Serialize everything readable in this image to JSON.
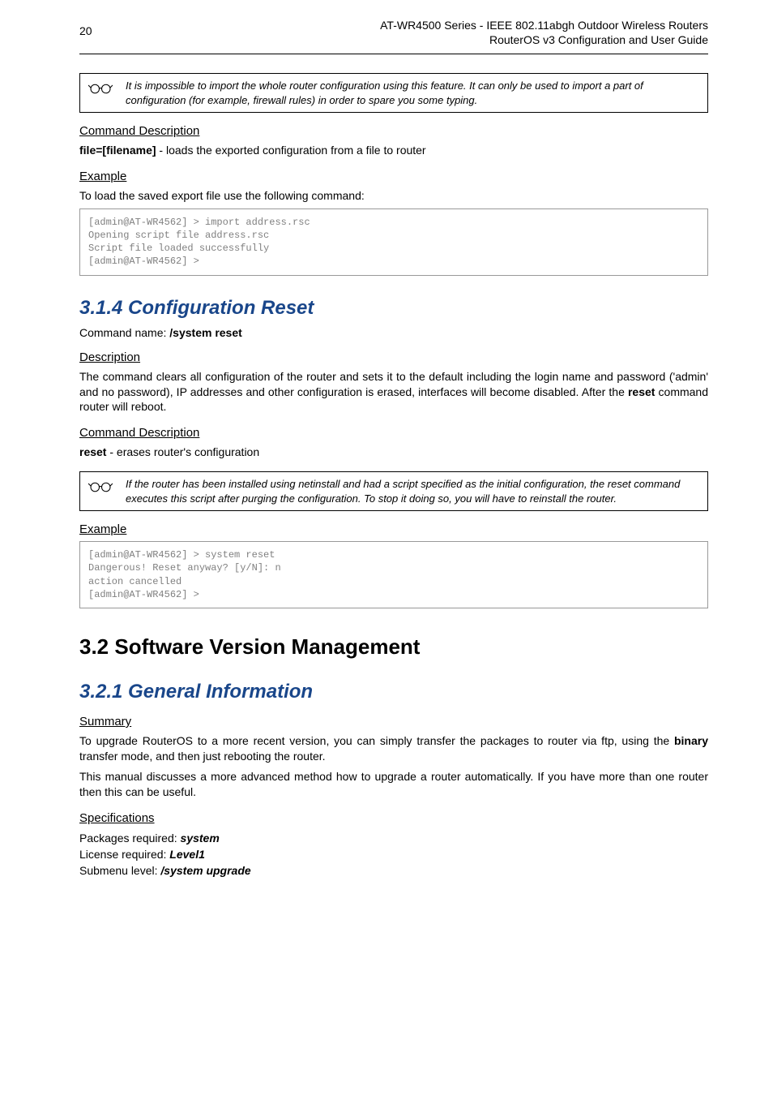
{
  "page_number": "20",
  "header": {
    "line1": "AT-WR4500 Series - IEEE 802.11abgh Outdoor Wireless Routers",
    "line2": "RouterOS v3 Configuration and User Guide"
  },
  "note1": "It is impossible to import the whole router configuration using this feature. It can only be used to import a part of configuration (for example, firewall rules) in order to spare you some typing.",
  "cmd_desc_h": "Command Description",
  "filekey": "file=[filename]",
  "filekey_desc": " - loads the exported configuration from a file to router",
  "example_h": "Example",
  "example1_intro": "To load the saved export file use the following command:",
  "code1": "[admin@AT-WR4562] > import address.rsc\nOpening script file address.rsc\nScript file loaded successfully\n[admin@AT-WR4562] >",
  "s314_title": "3.1.4  Configuration Reset",
  "s314_cmd_label": "Command name: ",
  "s314_cmd_val": "/system reset",
  "desc_h": "Description",
  "s314_desc_p": "The command clears all configuration of the router and sets it to the default including the login name and password ('admin' and no password), IP addresses and other configuration is erased, interfaces will become disabled. After the ",
  "s314_desc_bold": "reset",
  "s314_desc_tail": " command router will reboot.",
  "reset_key": "reset",
  "reset_desc": " - erases router's configuration",
  "note2": "If the router has been installed using netinstall and had a script specified as the initial configuration, the reset command executes this script after purging the configuration. To stop it doing so, you will have to reinstall the router.",
  "code2": "[admin@AT-WR4562] > system reset\nDangerous! Reset anyway? [y/N]: n\naction cancelled\n[admin@AT-WR4562] >",
  "s32_title": "3.2  Software Version Management",
  "s321_title": "3.2.1  General Information",
  "summary_h": "Summary",
  "summary_p1a": "To upgrade RouterOS to a more recent version, you can simply transfer the packages to router via ftp, using the ",
  "summary_p1_bold": "binary",
  "summary_p1b": " transfer mode, and then just rebooting the router.",
  "summary_p2": "This manual discusses a more advanced method how to upgrade a router automatically. If you have more than one router then this can be useful.",
  "specs_h": "Specifications",
  "specs": {
    "pkg_label": "Packages required: ",
    "pkg_val": "system",
    "lic_label": "License required: ",
    "lic_val": "Level1",
    "sub_label": "Submenu level: ",
    "sub_val": "/system upgrade"
  }
}
